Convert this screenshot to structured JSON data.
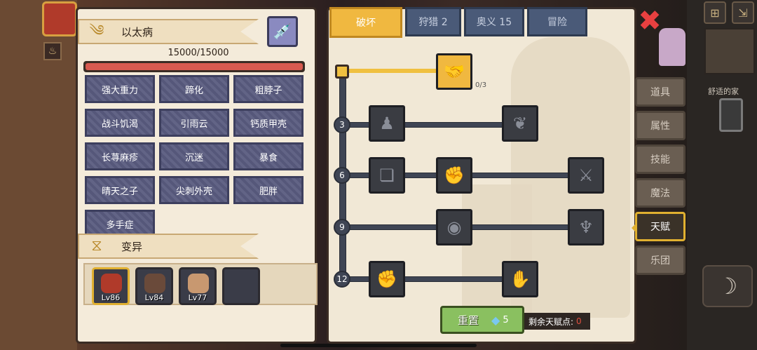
{
  "disease": {
    "title": "以太病",
    "hp_text": "15000/15000",
    "hp_fraction": 1.0,
    "icon": "wind-swirl-icon",
    "syringe_icon": "syringe-icon"
  },
  "traits": [
    "强大重力",
    "蹄化",
    "粗脖子",
    "战斗饥渴",
    "引雨云",
    "钙质甲壳",
    "长荨麻疹",
    "沉迷",
    "暴食",
    "晴天之子",
    "尖刺外壳",
    "肥胖",
    "多手症"
  ],
  "mutation": {
    "title": "变异",
    "icon": "dna-icon",
    "pets": [
      {
        "level": "Lv86",
        "selected": true
      },
      {
        "level": "Lv84",
        "selected": false
      },
      {
        "level": "Lv77",
        "selected": false
      },
      {
        "level": "",
        "selected": false
      }
    ]
  },
  "tabs": [
    {
      "label": "破坏",
      "active": true
    },
    {
      "label": "狩猎 2",
      "active": false
    },
    {
      "label": "奥义 15",
      "active": false
    },
    {
      "label": "冒险",
      "active": false
    }
  ],
  "talent_tree": {
    "top_skill": {
      "icon": "handshake-icon",
      "count": "0/3"
    },
    "rows": [
      {
        "level": "3",
        "skills": [
          "muscle-body-icon",
          "rose-icon"
        ]
      },
      {
        "level": "6",
        "skills": [
          "cards-icon",
          "punch-icon",
          "slash-icon"
        ]
      },
      {
        "level": "9",
        "skills": [
          "ripple-icon",
          "bat-icon"
        ]
      },
      {
        "level": "12",
        "skills": [
          "fist-icon",
          "hand-grab-icon"
        ]
      }
    ]
  },
  "reset": {
    "label": "重置",
    "cost": "5",
    "gem_icon": "diamond-icon"
  },
  "talent_points": {
    "label": "剩余天赋点:",
    "value": "0"
  },
  "side_menu": [
    {
      "label": "道具",
      "active": false
    },
    {
      "label": "属性",
      "active": false
    },
    {
      "label": "技能",
      "active": false
    },
    {
      "label": "魔法",
      "active": false
    },
    {
      "label": "天赋",
      "active": true
    },
    {
      "label": "乐团",
      "active": false
    }
  ],
  "hud": {
    "comfy_home": "舒适的家"
  },
  "colors": {
    "accent_gold": "#f0b840",
    "hp_red": "#d85a50",
    "trait_purple": "#5a5c80",
    "close_red": "#e84040"
  }
}
